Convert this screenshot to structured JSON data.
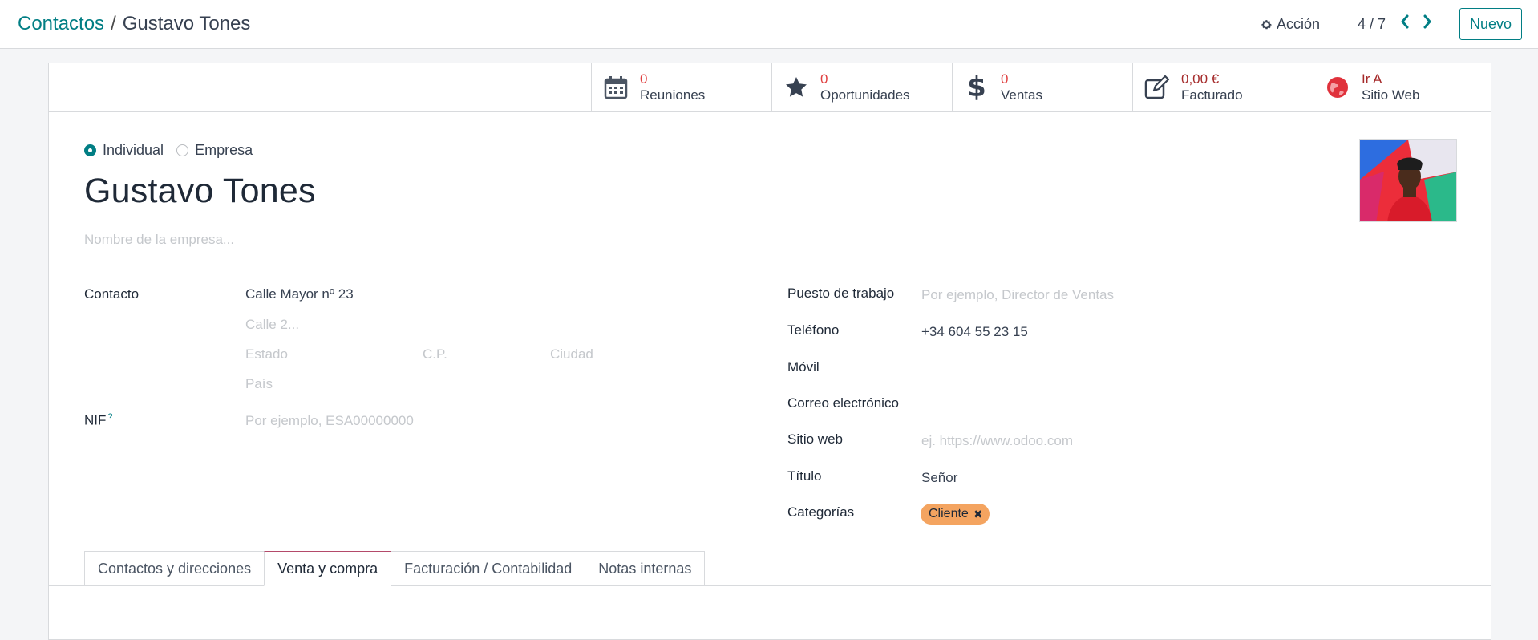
{
  "breadcrumb": {
    "parent": "Contactos",
    "separator": "/",
    "current": "Gustavo Tones"
  },
  "control": {
    "action_label": "Acción",
    "pager": "4 / 7",
    "new_label": "Nuevo"
  },
  "stat_buttons": [
    {
      "value": "0",
      "label": "Reuniones",
      "icon": "calendar-icon"
    },
    {
      "value": "0",
      "label": "Oportunidades",
      "icon": "star-icon"
    },
    {
      "value": "0",
      "label": "Ventas",
      "icon": "dollar-icon"
    },
    {
      "value": "0,00 €",
      "label": "Facturado",
      "icon": "edit-icon"
    },
    {
      "value": "Ir A",
      "label": "Sitio Web",
      "icon": "globe-icon"
    }
  ],
  "company_type": {
    "individual": "Individual",
    "company": "Empresa",
    "selected": "Individual"
  },
  "partner": {
    "name": "Gustavo Tones",
    "company_placeholder": "Nombre de la empresa..."
  },
  "address": {
    "label": "Contacto",
    "street": "Calle Mayor nº 23",
    "street2_placeholder": "Calle 2...",
    "state_placeholder": "Estado",
    "zip_placeholder": "C.P.",
    "city_placeholder": "Ciudad",
    "country_placeholder": "País"
  },
  "vat": {
    "label": "NIF",
    "help": "?",
    "placeholder": "Por ejemplo, ESA00000000"
  },
  "right_fields": {
    "job_label": "Puesto de trabajo",
    "job_placeholder": "Por ejemplo, Director de Ventas",
    "phone_label": "Teléfono",
    "phone_value": "+34 604 55 23 15",
    "mobile_label": "Móvil",
    "email_label": "Correo electrónico",
    "website_label": "Sitio web",
    "website_placeholder": "ej. https://www.odoo.com",
    "title_label": "Título",
    "title_value": "Señor",
    "categories_label": "Categorías"
  },
  "tags": [
    {
      "label": "Cliente",
      "color": "#f4a460"
    }
  ],
  "tabs": [
    {
      "label": "Contactos y direcciones",
      "active": false
    },
    {
      "label": "Venta y compra",
      "active": true
    },
    {
      "label": "Facturación / Contabilidad",
      "active": false
    },
    {
      "label": "Notas internas",
      "active": false
    }
  ],
  "colors": {
    "primary": "#017e84",
    "stat_value": "#e04040"
  }
}
